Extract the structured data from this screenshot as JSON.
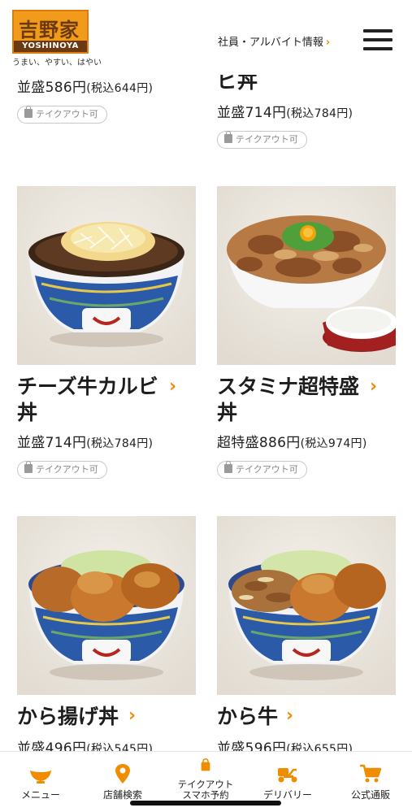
{
  "header": {
    "logo_text": "吉野家",
    "logo_roman": "YOSHINOYA",
    "tagline": "うまい、やすい、はやい",
    "staff_link": "社員・アルバイト情報"
  },
  "menu_items": [
    {
      "name": "",
      "price": "並盛586円",
      "tax": "(税込644円)",
      "takeout": "テイクアウト可"
    },
    {
      "name": "ビ丼",
      "price": "並盛714円",
      "tax": "(税込784円)",
      "takeout": "テイクアウト可"
    },
    {
      "name": "チーズ牛カルビ丼",
      "price": "並盛714円",
      "tax": "(税込784円)",
      "takeout": "テイクアウト可"
    },
    {
      "name": "スタミナ超特盛丼",
      "price": "超特盛886円",
      "tax": "(税込974円)",
      "takeout": "テイクアウト可"
    },
    {
      "name": "から揚げ丼",
      "price": "並盛496円",
      "tax": "(税込545円)",
      "takeout": ""
    },
    {
      "name": "から牛",
      "price": "並盛596円",
      "tax": "(税込655円)",
      "takeout": ""
    }
  ],
  "bottom_nav": {
    "menu": "メニュー",
    "store_search": "店舗検索",
    "takeout_line1": "テイクアウト",
    "takeout_line2": "スマホ予約",
    "delivery": "デリバリー",
    "shop": "公式通販"
  },
  "colors": {
    "accent": "#f08c00",
    "logo_orange": "#f29a1a",
    "logo_brown": "#6b3a12",
    "pill_border": "#c8c8c8"
  },
  "icons": {
    "chevron": "›",
    "takeout_bag": "bag-icon"
  }
}
